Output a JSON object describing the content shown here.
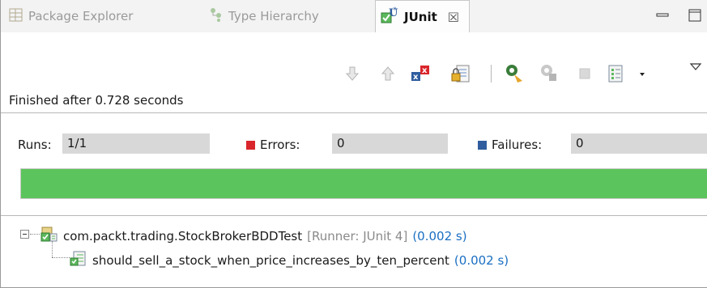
{
  "tabs": [
    {
      "label": "Package Explorer",
      "icon": "package-explorer-icon",
      "active": false
    },
    {
      "label": "Type Hierarchy",
      "icon": "type-hierarchy-icon",
      "active": false
    },
    {
      "label": "JUnit",
      "icon": "junit-icon",
      "active": true,
      "close": "☒"
    }
  ],
  "toolbar": {
    "icons": [
      "next-failure-icon",
      "previous-failure-icon",
      "show-failures-only-icon",
      "scroll-lock-icon",
      "rerun-test-icon",
      "rerun-failures-first-icon",
      "stop-icon",
      "test-run-history-icon",
      "history-dropdown-icon"
    ]
  },
  "status": "Finished after 0.728 seconds",
  "counters": {
    "runs_label": "Runs:",
    "runs_value": "1/1",
    "errors_label": "Errors:",
    "errors_value": "0",
    "failures_label": "Failures:",
    "failures_value": "0"
  },
  "progress": {
    "fraction": 1.0,
    "color": "#5cc45c"
  },
  "tree": {
    "suite": {
      "name": "com.packt.trading.StockBrokerBDDTest",
      "runner": "[Runner: JUnit 4]",
      "time": "(0.002 s)"
    },
    "test": {
      "name": "should_sell_a_stock_when_price_increases_by_ten_percent",
      "time": "(0.002 s)"
    }
  },
  "colors": {
    "error": "#d9262c",
    "failure": "#2f5d9e",
    "success": "#5cc45c",
    "time": "#1a6fc2"
  }
}
